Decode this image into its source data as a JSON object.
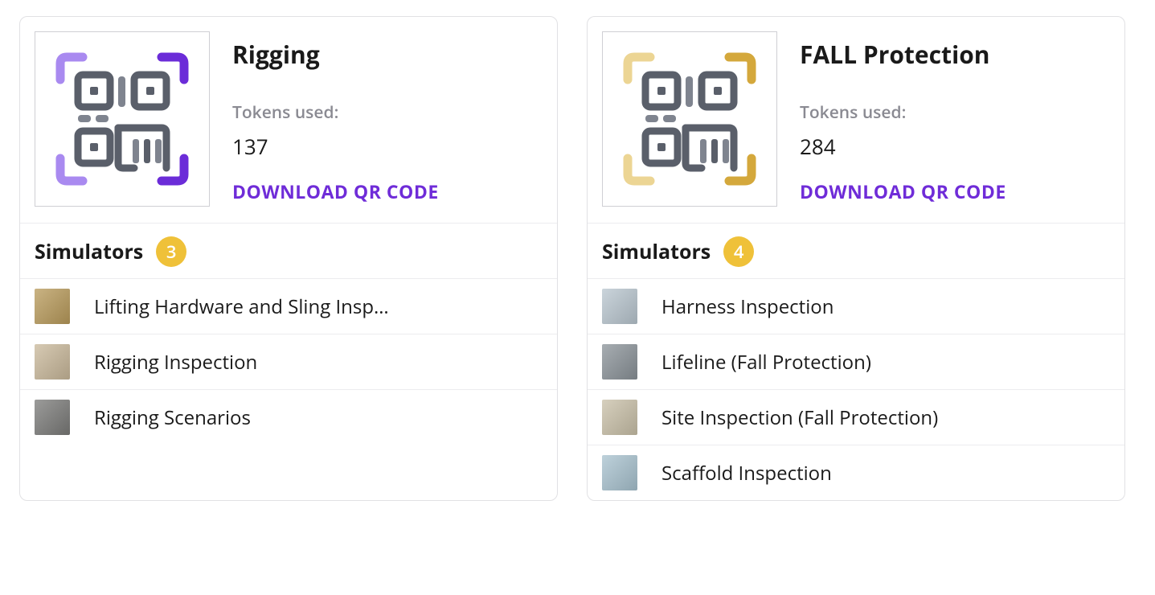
{
  "common": {
    "tokens_label": "Tokens used:",
    "download_label": "DOWNLOAD QR CODE",
    "simulators_label": "Simulators"
  },
  "cards": [
    {
      "title": "Rigging",
      "tokens": "137",
      "accent_primary": "#6b2cd8",
      "accent_secondary": "#a98af0",
      "simulator_count": "3",
      "simulators": [
        {
          "name": "Lifting Hardware and Sling Insp…",
          "thumb_bg": "#b89a5a"
        },
        {
          "name": "Rigging Inspection",
          "thumb_bg": "#c9b89a"
        },
        {
          "name": "Rigging Scenarios",
          "thumb_bg": "#7a7a78"
        }
      ]
    },
    {
      "title": "FALL Protection",
      "tokens": "284",
      "accent_primary": "#d4a83c",
      "accent_secondary": "#ecd594",
      "simulator_count": "4",
      "simulators": [
        {
          "name": "Harness Inspection",
          "thumb_bg": "#b9c6cf"
        },
        {
          "name": "Lifeline (Fall Protection)",
          "thumb_bg": "#8a9298"
        },
        {
          "name": "Site Inspection (Fall Protection)",
          "thumb_bg": "#c9c0a8"
        },
        {
          "name": "Scaffold Inspection",
          "thumb_bg": "#a8c2cf"
        }
      ]
    }
  ]
}
